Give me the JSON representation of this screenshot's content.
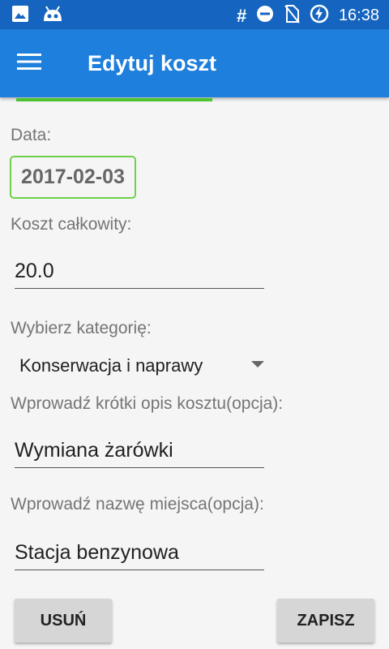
{
  "status_bar": {
    "time": "16:38",
    "hash": "#",
    "icons": [
      "image-icon",
      "android-icon",
      "do-not-disturb-icon",
      "no-signal-icon",
      "battery-charging-icon"
    ]
  },
  "app_bar": {
    "title": "Edytuj koszt",
    "menu_icon": "hamburger-menu-icon"
  },
  "form": {
    "date_label": "Data:",
    "date_value": "2017-02-03",
    "cost_label": "Koszt całkowity:",
    "cost_value": "20.0",
    "category_label": "Wybierz kategorię:",
    "category_value": "Konserwacja i naprawy",
    "description_label": "Wprowadź krótki opis kosztu(opcja):",
    "description_value": "Wymiana żarówki",
    "place_label": "Wprowadź nazwę miejsca(opcja):",
    "place_value": "Stacja benzynowa"
  },
  "buttons": {
    "delete": "USUŃ",
    "save": "ZAPISZ"
  },
  "colors": {
    "status_bar": "#1565c0",
    "app_bar": "#1e7fdc",
    "accent_green": "#4cc42e",
    "background": "#f5f5f5"
  }
}
